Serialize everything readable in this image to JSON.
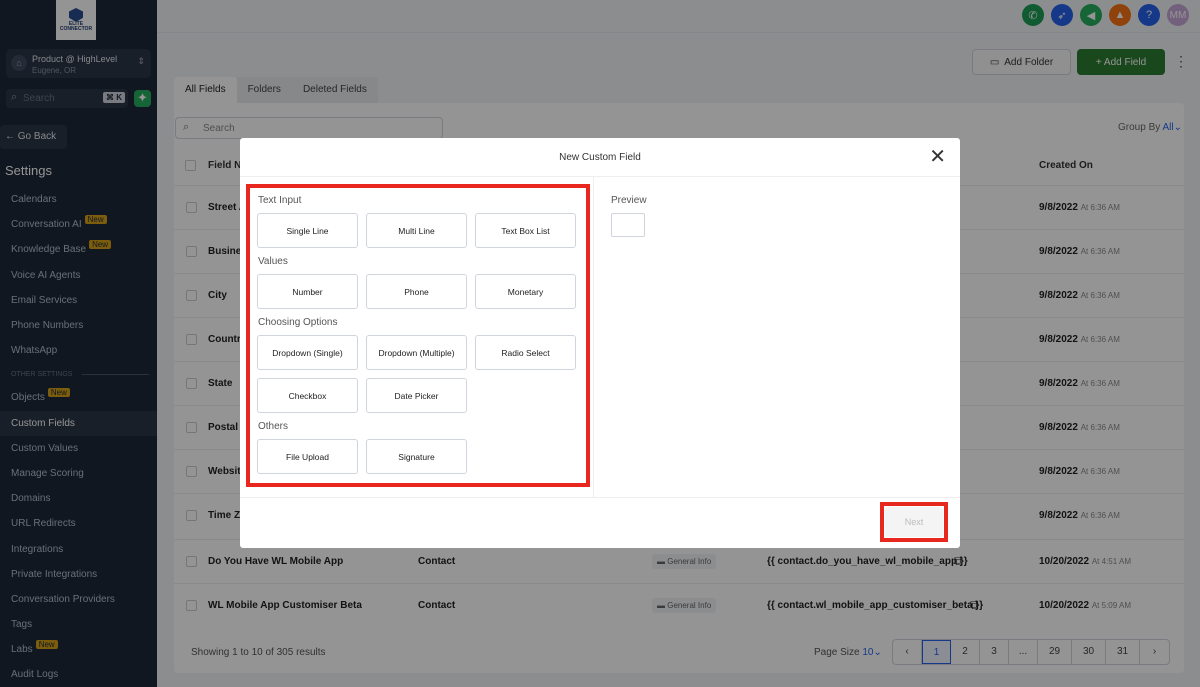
{
  "sidebar": {
    "logo_text": "ELITE CONNECTOR",
    "account_name": "Product @ HighLevel",
    "account_location": "Eugene, OR",
    "account_initial": "⌂",
    "search_placeholder": "Search",
    "search_shortcut": "⌘ K",
    "go_back": "← Go Back",
    "settings_heading": "Settings",
    "section_other": "OTHER SETTINGS",
    "new_badge": "New",
    "items": [
      {
        "label": "Calendars"
      },
      {
        "label": "Conversation AI",
        "badge": "New"
      },
      {
        "label": "Knowledge Base",
        "badge": "New"
      },
      {
        "label": "Voice AI Agents"
      },
      {
        "label": "Email Services"
      },
      {
        "label": "Phone Numbers"
      },
      {
        "label": "WhatsApp"
      }
    ],
    "other_items": [
      {
        "label": "Objects",
        "badge": "New"
      },
      {
        "label": "Custom Fields",
        "active": true
      },
      {
        "label": "Custom Values"
      },
      {
        "label": "Manage Scoring"
      },
      {
        "label": "Domains"
      },
      {
        "label": "URL Redirects"
      },
      {
        "label": "Integrations"
      },
      {
        "label": "Private Integrations"
      },
      {
        "label": "Conversation Providers"
      },
      {
        "label": "Tags"
      },
      {
        "label": "Labs",
        "badge": "New"
      },
      {
        "label": "Audit Logs"
      }
    ]
  },
  "topbar": {
    "icons": [
      "phone-icon",
      "rocket-icon",
      "megaphone-icon",
      "bell-icon",
      "help-icon"
    ],
    "avatar_initials": "MM"
  },
  "toolbar": {
    "add_folder": "Add Folder",
    "add_field": "+ Add Field"
  },
  "tabs": [
    "All Fields",
    "Folders",
    "Deleted Fields"
  ],
  "table": {
    "search_placeholder": "Search",
    "group_by_label": "Group By",
    "group_by_value": "All",
    "headers": {
      "field_name": "Field N",
      "created_on": "Created On"
    },
    "rows": [
      {
        "name": "Street A",
        "date": "9/8/2022",
        "time": "At 6:36 AM"
      },
      {
        "name": "Busine",
        "date": "9/8/2022",
        "time": "At 6:36 AM"
      },
      {
        "name": "City",
        "date": "9/8/2022",
        "time": "At 6:36 AM"
      },
      {
        "name": "Countr",
        "date": "9/8/2022",
        "time": "At 6:36 AM"
      },
      {
        "name": "State",
        "date": "9/8/2022",
        "time": "At 6:36 AM"
      },
      {
        "name": "Postal C",
        "date": "9/8/2022",
        "time": "At 6:36 AM"
      },
      {
        "name": "Website",
        "date": "9/8/2022",
        "time": "At 6:36 AM"
      },
      {
        "name": "Time Zo",
        "date": "9/8/2022",
        "time": "At 6:36 AM"
      },
      {
        "name": "Do You Have WL Mobile App",
        "object": "Contact",
        "folder": "General Info",
        "key": "{{ contact.do_you_have_wl_mobile_app }}",
        "date": "10/20/2022",
        "time": "At 4:51 AM"
      },
      {
        "name": "WL Mobile App Customiser Beta",
        "object": "Contact",
        "folder": "General Info",
        "key": "{{ contact.wl_mobile_app_customiser_beta }}",
        "date": "10/20/2022",
        "time": "At 5:09 AM"
      }
    ],
    "showing_text": "Showing 1 to 10 of 305 results",
    "page_size_label": "Page Size",
    "page_size_value": "10",
    "pages": [
      "‹",
      "1",
      "2",
      "3",
      "...",
      "29",
      "30",
      "31",
      "›"
    ]
  },
  "modal": {
    "title": "New Custom Field",
    "groups": [
      {
        "label": "Text Input",
        "options": [
          "Single Line",
          "Multi Line",
          "Text Box List"
        ]
      },
      {
        "label": "Values",
        "options": [
          "Number",
          "Phone",
          "Monetary"
        ]
      },
      {
        "label": "Choosing Options",
        "options": [
          "Dropdown (Single)",
          "Dropdown (Multiple)",
          "Radio Select",
          "Checkbox",
          "Date Picker"
        ]
      },
      {
        "label": "Others",
        "options": [
          "File Upload",
          "Signature"
        ]
      }
    ],
    "preview_label": "Preview",
    "next_label": "Next"
  },
  "colors": {
    "sidebar_bg": "#1d2939",
    "accent_green": "#2e7d32",
    "highlight_red": "#e8281e",
    "link_blue": "#2563eb"
  }
}
